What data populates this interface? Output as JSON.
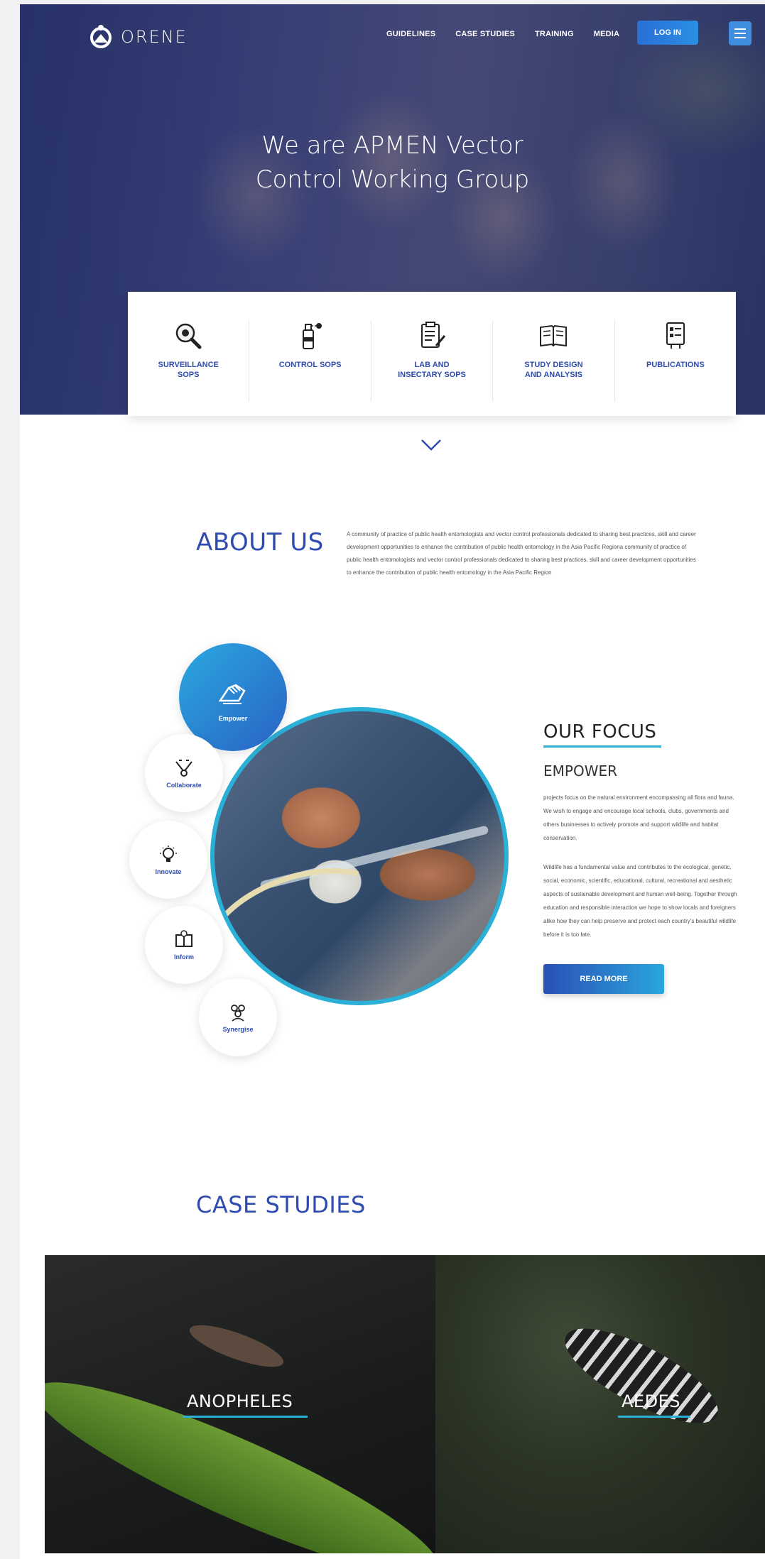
{
  "brand": {
    "name": "ORENE"
  },
  "nav": {
    "links": [
      "GUIDELINES",
      "CASE STUDIES",
      "TRAINING",
      "MEDIA"
    ],
    "login_label": "LOG IN"
  },
  "hero": {
    "title_line1": "We are APMEN Vector",
    "title_line2": "Control Working Group"
  },
  "categories": [
    {
      "label_line1": "SURVEILLANCE",
      "label_line2": "SOPS",
      "icon": "magnifier-bug-icon"
    },
    {
      "label_line1": "CONTROL SOPS",
      "label_line2": "",
      "icon": "spray-can-icon"
    },
    {
      "label_line1": "LAB AND",
      "label_line2": "INSECTARY SOPS",
      "icon": "clipboard-pen-icon"
    },
    {
      "label_line1": "STUDY DESIGN",
      "label_line2": "AND ANALYSIS",
      "icon": "book-icon"
    },
    {
      "label_line1": "PUBLICATIONS",
      "label_line2": "",
      "icon": "document-list-icon"
    }
  ],
  "about": {
    "title": "ABOUT US",
    "text": "A community of practice of public health entomologists and vector control professionals dedicated to sharing best practices, skill and career development opportunities to enhance the contribution of public health entomology in the Asia Pacific Regiona community of practice of public health entomologists and vector control professionals dedicated to sharing best practices, skill and career development opportunities to enhance the contribution of public health entomology in the Asia Pacific Region"
  },
  "focus": {
    "title": "OUR FOCUS",
    "subtitle": "EMPOWER",
    "paragraph1": "projects focus on the natural environment encompassing all flora and fauna. We wish to engage and encourage local schools, clubs, governments and others businesses to actively promote and support wildlife and habitat conservation.",
    "paragraph2": "Wildlife has a fundamental value and contributes to the ecological, genetic, social, economic, scientific, educational, cultural, recreational and aesthetic aspects of sustainable development and human well-being. Together through education and responsible interaction we hope to show locals and foreigners alike how they can help preserve and protect each country's beautiful wildlife before it is too late.",
    "read_more_label": "READ MORE",
    "items": [
      {
        "label": "Empower",
        "active": true
      },
      {
        "label": "Collaborate",
        "active": false
      },
      {
        "label": "Innovate",
        "active": false
      },
      {
        "label": "Inform",
        "active": false
      },
      {
        "label": "Synergise",
        "active": false
      }
    ]
  },
  "case_studies": {
    "title": "CASE STUDIES",
    "tiles": [
      {
        "label": "ANOPHELES"
      },
      {
        "label": "AEDES"
      }
    ]
  },
  "colors": {
    "primary": "#2e4bb0",
    "accent": "#2bb0d8",
    "button": "#2a6fd6"
  }
}
